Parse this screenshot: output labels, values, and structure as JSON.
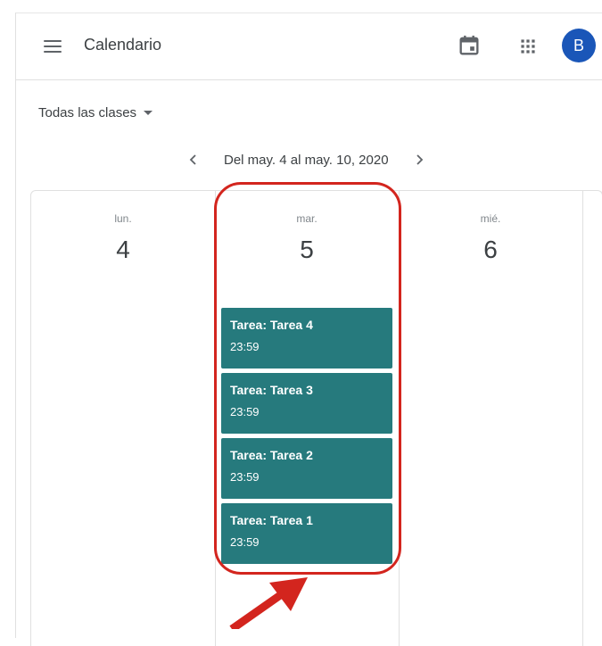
{
  "header": {
    "title": "Calendario",
    "avatar_letter": "B",
    "menu_icon": "hamburger-menu-icon",
    "calendar_icon": "calendar-icon",
    "apps_icon": "apps-grid-icon"
  },
  "filter": {
    "label": "Todas las clases"
  },
  "week_nav": {
    "range": "Del may. 4 al may. 10, 2020",
    "prev_icon": "chevron-left-icon",
    "next_icon": "chevron-right-icon"
  },
  "days": [
    {
      "dow": "lun.",
      "date": "4",
      "events": []
    },
    {
      "dow": "mar.",
      "date": "5",
      "events": [
        {
          "title": "Tarea: Tarea 4",
          "time": "23:59"
        },
        {
          "title": "Tarea: Tarea 3",
          "time": "23:59"
        },
        {
          "title": "Tarea: Tarea 2",
          "time": "23:59"
        },
        {
          "title": "Tarea: Tarea 1",
          "time": "23:59"
        }
      ]
    },
    {
      "dow": "mié.",
      "date": "6",
      "events": []
    }
  ],
  "colors": {
    "event_bg": "#267a7d",
    "avatar_bg": "#1a56b8",
    "annotation": "#d3251e"
  }
}
